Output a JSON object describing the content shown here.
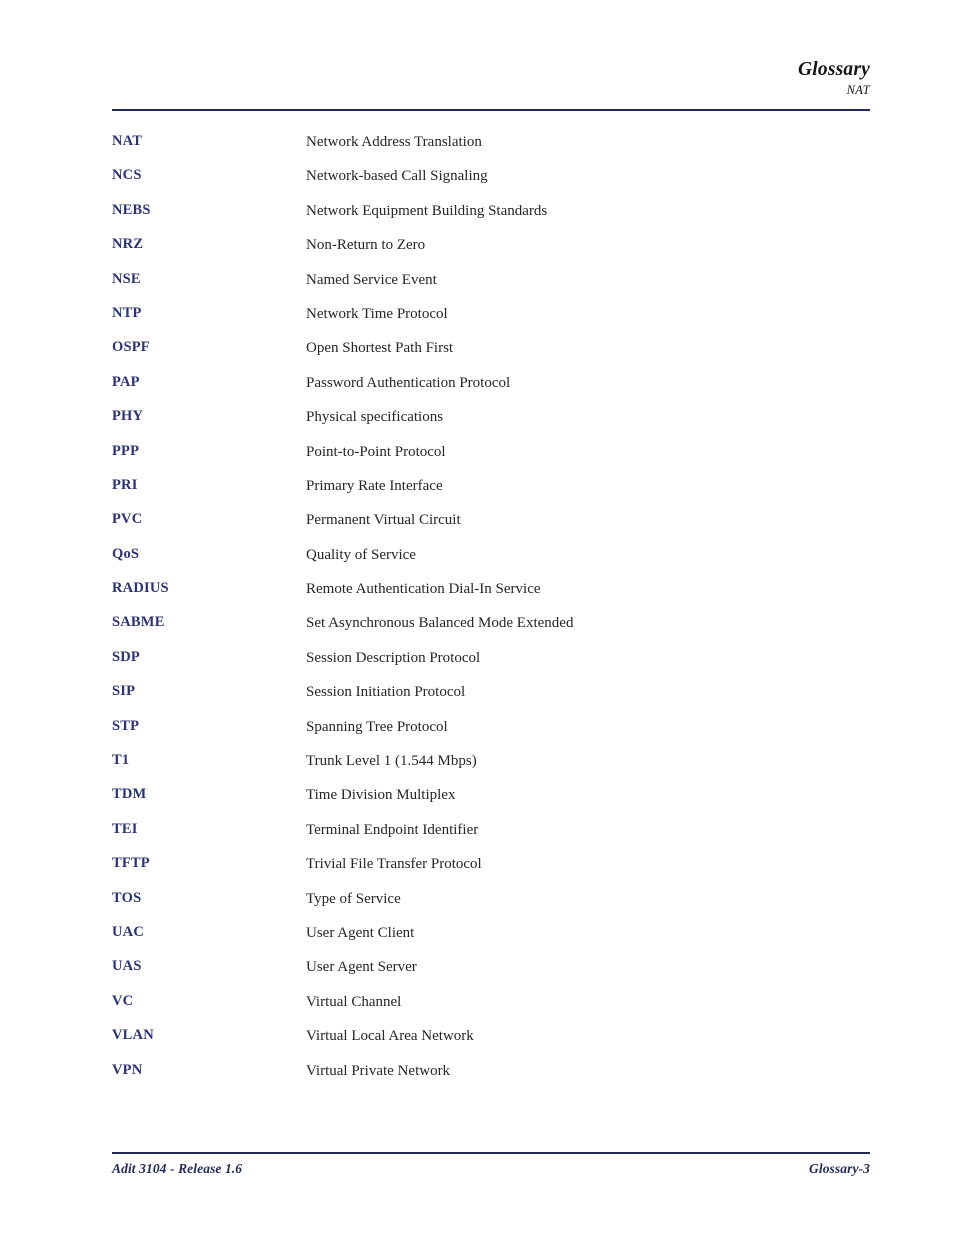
{
  "header": {
    "title": "Glossary",
    "subtitle": "NAT"
  },
  "glossary": {
    "entries": [
      {
        "term": "NAT",
        "definition": "Network Address Translation"
      },
      {
        "term": "NCS",
        "definition": "Network-based Call Signaling"
      },
      {
        "term": "NEBS",
        "definition": "Network Equipment Building Standards"
      },
      {
        "term": "NRZ",
        "definition": "Non-Return to Zero"
      },
      {
        "term": "NSE",
        "definition": "Named Service Event"
      },
      {
        "term": "NTP",
        "definition": "Network Time Protocol"
      },
      {
        "term": "OSPF",
        "definition": "Open Shortest Path First"
      },
      {
        "term": "PAP",
        "definition": "Password Authentication Protocol"
      },
      {
        "term": "PHY",
        "definition": "Physical specifications"
      },
      {
        "term": "PPP",
        "definition": "Point-to-Point Protocol"
      },
      {
        "term": "PRI",
        "definition": "Primary Rate Interface"
      },
      {
        "term": "PVC",
        "definition": "Permanent Virtual Circuit"
      },
      {
        "term": "QoS",
        "definition": "Quality of Service"
      },
      {
        "term": "RADIUS",
        "definition": "Remote Authentication Dial-In Service"
      },
      {
        "term": "SABME",
        "definition": "Set Asynchronous Balanced Mode Extended"
      },
      {
        "term": "SDP",
        "definition": "Session Description Protocol"
      },
      {
        "term": "SIP",
        "definition": "Session Initiation Protocol"
      },
      {
        "term": "STP",
        "definition": "Spanning Tree Protocol"
      },
      {
        "term": "T1",
        "definition": "Trunk Level 1 (1.544 Mbps)"
      },
      {
        "term": "TDM",
        "definition": "Time Division Multiplex"
      },
      {
        "term": "TEI",
        "definition": "Terminal Endpoint Identifier"
      },
      {
        "term": "TFTP",
        "definition": "Trivial File Transfer Protocol"
      },
      {
        "term": "TOS",
        "definition": "Type of Service"
      },
      {
        "term": "UAC",
        "definition": "User Agent Client"
      },
      {
        "term": "UAS",
        "definition": "User Agent Server"
      },
      {
        "term": "VC",
        "definition": "Virtual Channel"
      },
      {
        "term": "VLAN",
        "definition": "Virtual Local Area Network"
      },
      {
        "term": "VPN",
        "definition": "Virtual Private Network"
      }
    ]
  },
  "footer": {
    "left": "Adit 3104 - Release 1.6",
    "right": "Glossary-3"
  },
  "colors": {
    "term": "#2b3275",
    "rule": "#232a5c",
    "definition": "#262626",
    "page_background": "#ffffff"
  }
}
